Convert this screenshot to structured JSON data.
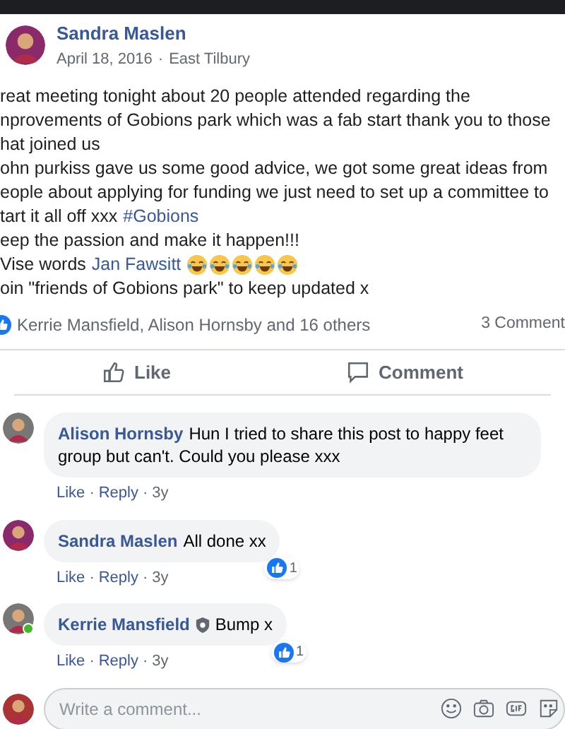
{
  "post": {
    "author": "Sandra Maslen",
    "date": "April 18, 2016",
    "separator": "·",
    "place": "East Tilbury",
    "lines": [
      {
        "text": "reat meeting tonight about 20 people attended regarding the"
      },
      {
        "text": "nprovements of Gobions park which was a fab start thank you to those"
      },
      {
        "text": "hat joined us"
      },
      {
        "text": "ohn purkiss gave us some good advice, we got some great ideas from"
      },
      {
        "text": "eople about applying for funding we just need to set up a committee to"
      },
      {
        "text": "tart it all off xxx",
        "link": "#Gobions"
      },
      {
        "text": "eep the passion and make it happen!!!"
      },
      {
        "text": "Vise words",
        "link": "Jan Fawsitt",
        "emojis": true
      },
      {
        "text": "oin \"friends of Gobions park\" to keep updated x"
      }
    ],
    "reactions": "Kerrie Mansfield, Alison Hornsby and 16 others",
    "comments_count": "3 Comment"
  },
  "actions": [
    "Like",
    "Comment"
  ],
  "comments": [
    {
      "author": "Alison Hornsby",
      "badge": false,
      "text": "Hun I tried to share this post to happy feet group but can't. Could you please xxx",
      "online": false,
      "links": [
        {
          "kind": "like",
          "text": "Like"
        },
        {
          "kind": "sep",
          "text": "·"
        },
        {
          "kind": "reply",
          "text": "Reply"
        },
        {
          "kind": "sep",
          "text": "·"
        },
        {
          "kind": "time",
          "text": "3y"
        }
      ]
    },
    {
      "author": "Sandra Maslen",
      "badge": false,
      "text": "All done xx",
      "likes": "1",
      "online": false,
      "links": [
        {
          "kind": "like",
          "text": "Like"
        },
        {
          "kind": "sep",
          "text": "·"
        },
        {
          "kind": "reply",
          "text": "Reply"
        },
        {
          "kind": "sep",
          "text": "·"
        },
        {
          "kind": "time",
          "text": "3y"
        }
      ]
    },
    {
      "author": "Kerrie Mansfield",
      "badge": true,
      "text": "Bump x",
      "likes": "1",
      "online": true,
      "links": [
        {
          "kind": "like",
          "text": "Like"
        },
        {
          "kind": "sep",
          "text": "·"
        },
        {
          "kind": "reply",
          "text": "Reply"
        },
        {
          "kind": "sep",
          "text": "·"
        },
        {
          "kind": "time",
          "text": "3y"
        }
      ]
    }
  ],
  "composer": {
    "placeholder": "Write a comment..."
  }
}
